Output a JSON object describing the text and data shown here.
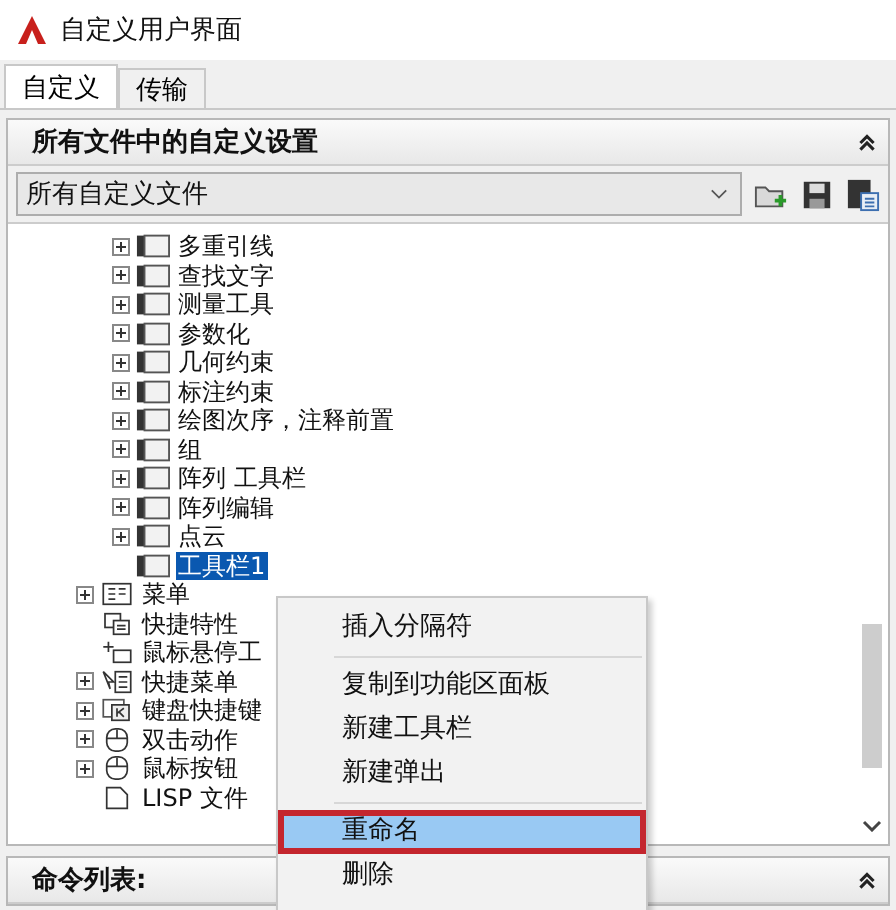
{
  "window": {
    "title": "自定义用户界面"
  },
  "tabs": [
    {
      "label": "自定义",
      "selected": true
    },
    {
      "label": "传输",
      "selected": false
    }
  ],
  "panel": {
    "title": "所有文件中的自定义设置",
    "file_select": {
      "value": "所有自定义文件"
    }
  },
  "tree": {
    "items": [
      {
        "children": [
          {
            "label": "多重引线",
            "kind": "toolbar",
            "expandable": true,
            "selected": false
          },
          {
            "label": "查找文字",
            "kind": "toolbar",
            "expandable": true,
            "selected": false
          },
          {
            "label": "测量工具",
            "kind": "toolbar",
            "expandable": true,
            "selected": false
          },
          {
            "label": "参数化",
            "kind": "toolbar",
            "expandable": true,
            "selected": false
          },
          {
            "label": "几何约束",
            "kind": "toolbar",
            "expandable": true,
            "selected": false
          },
          {
            "label": "标注约束",
            "kind": "toolbar",
            "expandable": true,
            "selected": false
          },
          {
            "label": "绘图次序，注释前置",
            "kind": "toolbar",
            "expandable": true,
            "selected": false
          },
          {
            "label": "组",
            "kind": "toolbar",
            "expandable": true,
            "selected": false
          },
          {
            "label": "阵列 工具栏",
            "kind": "toolbar",
            "expandable": true,
            "selected": false
          },
          {
            "label": "阵列编辑",
            "kind": "toolbar",
            "expandable": true,
            "selected": false
          },
          {
            "label": "点云",
            "kind": "toolbar",
            "expandable": true,
            "selected": false
          },
          {
            "label": "工具栏1",
            "kind": "toolbar",
            "expandable": false,
            "selected": true
          }
        ]
      },
      {
        "label": "菜单",
        "kind": "menu",
        "expandable": true,
        "selected": false
      },
      {
        "label": "快捷特性",
        "kind": "properties",
        "expandable": false,
        "selected": false
      },
      {
        "label": "鼠标悬停工",
        "kind": "rollover",
        "expandable": false,
        "selected": false
      },
      {
        "label": "快捷菜单",
        "kind": "shortcut-menu",
        "expandable": true,
        "selected": false
      },
      {
        "label": "键盘快捷键",
        "kind": "keyboard",
        "expandable": true,
        "selected": false
      },
      {
        "label": "双击动作",
        "kind": "mouse",
        "expandable": true,
        "selected": false
      },
      {
        "label": "鼠标按钮",
        "kind": "mouse",
        "expandable": true,
        "selected": false
      },
      {
        "label": "LISP 文件",
        "kind": "file",
        "expandable": false,
        "selected": false
      }
    ]
  },
  "context_menu": {
    "items": [
      {
        "kind": "item",
        "label": "插入分隔符",
        "selected": false,
        "marked": false
      },
      {
        "kind": "separator"
      },
      {
        "kind": "item",
        "label": "复制到功能区面板",
        "selected": false,
        "marked": false
      },
      {
        "kind": "item",
        "label": "新建工具栏",
        "selected": false,
        "marked": false
      },
      {
        "kind": "item",
        "label": "新建弹出",
        "selected": false,
        "marked": false
      },
      {
        "kind": "separator"
      },
      {
        "kind": "item",
        "label": "重命名",
        "selected": true,
        "marked": true
      },
      {
        "kind": "item",
        "label": "删除",
        "selected": false,
        "marked": false
      }
    ]
  },
  "command_panel": {
    "title": "命令列表:"
  }
}
